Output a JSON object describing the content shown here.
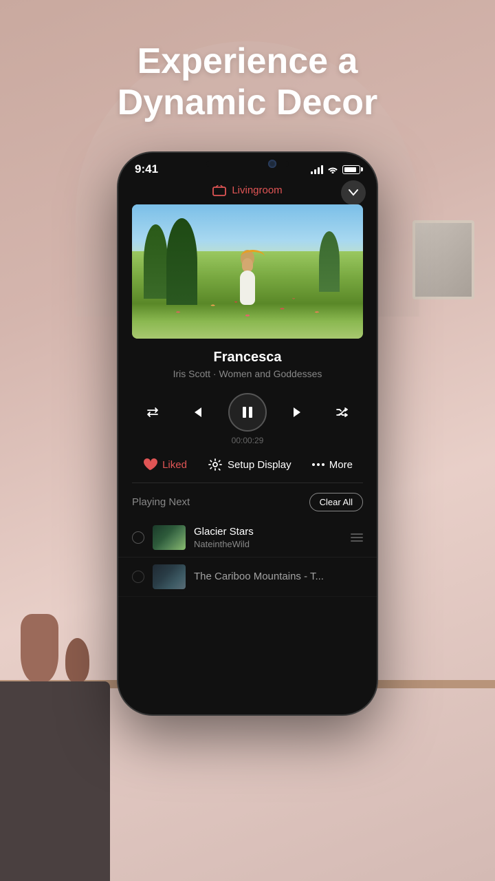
{
  "page": {
    "hero_title_line1": "Experience a",
    "hero_title_line2": "Dynamic Decor"
  },
  "status_bar": {
    "time": "9:41"
  },
  "app": {
    "room_label": "Livingroom",
    "chevron_label": "chevron down",
    "artwork_title": "Francesca",
    "artwork_subtitle": "Iris Scott · Women and Goddesses",
    "playback_time": "00:00:29",
    "controls": {
      "repeat_label": "Repeat",
      "prev_label": "Previous",
      "pause_label": "Pause",
      "next_label": "Next",
      "shuffle_label": "Shuffle"
    },
    "actions": {
      "liked_label": "Liked",
      "setup_display_label": "Setup Display",
      "more_label": "More"
    },
    "queue": {
      "section_label": "Playing Next",
      "clear_all_label": "Clear All",
      "items": [
        {
          "title": "Glacier Stars",
          "artist": "NateintheWild"
        },
        {
          "title": "The Cariboo Mountains - T...",
          "artist": ""
        }
      ]
    }
  }
}
